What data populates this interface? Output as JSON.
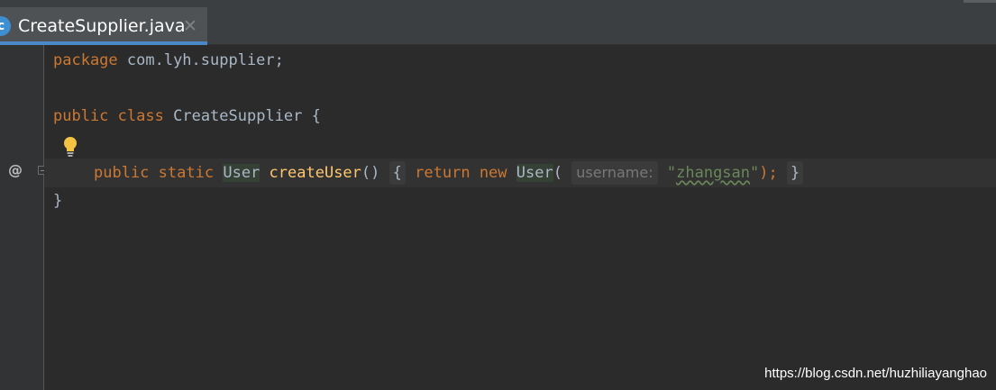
{
  "tab": {
    "file_name": "CreateSupplier.java",
    "close_glyph": "✕",
    "icon_glyph": "c"
  },
  "gutter": {
    "at_symbol": "@"
  },
  "code": {
    "line1": {
      "kw": "package",
      "rest": " com.lyh.supplier;"
    },
    "line2": {
      "kw1": "public",
      "kw2": "class",
      "name": "CreateSupplier",
      "brace": "{"
    },
    "line3": {
      "kw1": "public",
      "kw2": "static",
      "type1": "User",
      "method": "createUser",
      "parens": "()",
      "open_brace": "{",
      "kw_return": "return",
      "kw_new": "new",
      "type2": "User",
      "open_paren": "(",
      "hint_label": "username:",
      "string_open": "\"",
      "string_value": "zhangsan",
      "string_close": "\"",
      "close_stmt": ");",
      "close_brace": "}"
    },
    "line4": {
      "brace": "}"
    }
  },
  "watermark": "https://blog.csdn.net/huzhiliayanghao",
  "colors": {
    "keyword": "#cc7832",
    "method": "#ffc66d",
    "string": "#6a8759",
    "text": "#a9b7c6",
    "tab_accent": "#4a88c7"
  }
}
